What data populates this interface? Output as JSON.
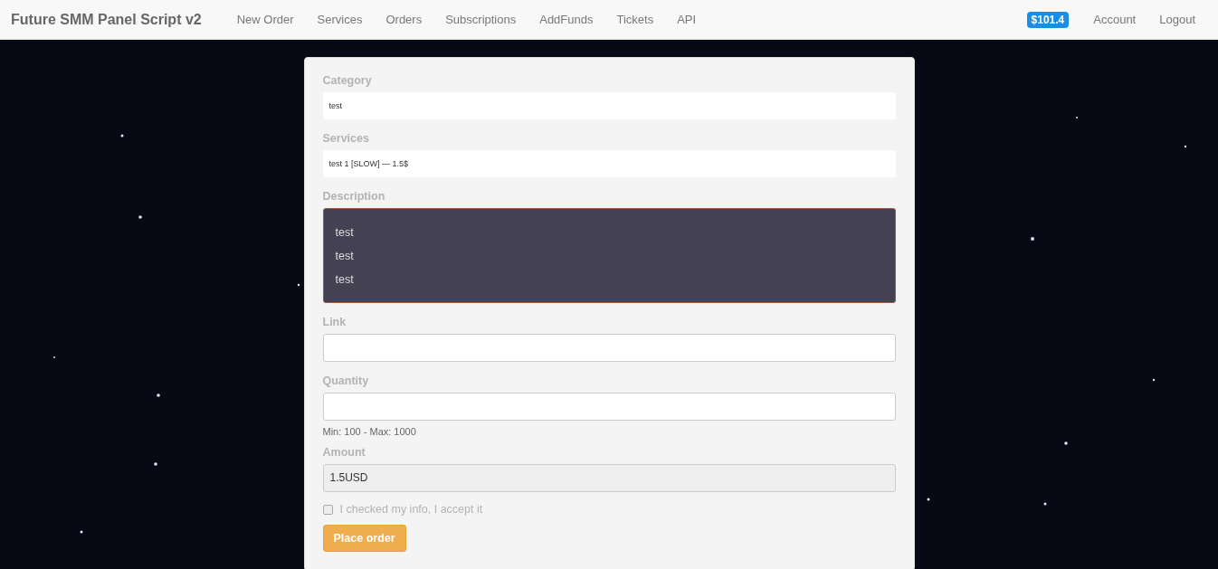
{
  "navbar": {
    "brand": "Future SMM Panel Script v2",
    "links": [
      "New Order",
      "Services",
      "Orders",
      "Subscriptions",
      "AddFunds",
      "Tickets",
      "API"
    ],
    "balance": "$101.4",
    "right_links": [
      "Account",
      "Logout"
    ]
  },
  "form": {
    "fields": [
      {
        "kind": "select",
        "label": "Category",
        "value": "test"
      },
      {
        "kind": "select",
        "label": "Services",
        "value": "test 1 [SLOW] — 1.5$"
      },
      {
        "kind": "description",
        "label": "Description",
        "lines": [
          "test",
          "test",
          "test"
        ]
      },
      {
        "kind": "input",
        "label": "Link"
      },
      {
        "kind": "input",
        "label": "Quantity",
        "help": "Min: 100 - Max: 1000"
      },
      {
        "kind": "readonly",
        "label": "Amount",
        "value": "1.5USD"
      }
    ],
    "agreement": {
      "label": "I checked my info, I accept it",
      "checked": false
    },
    "submit": "Place order"
  }
}
